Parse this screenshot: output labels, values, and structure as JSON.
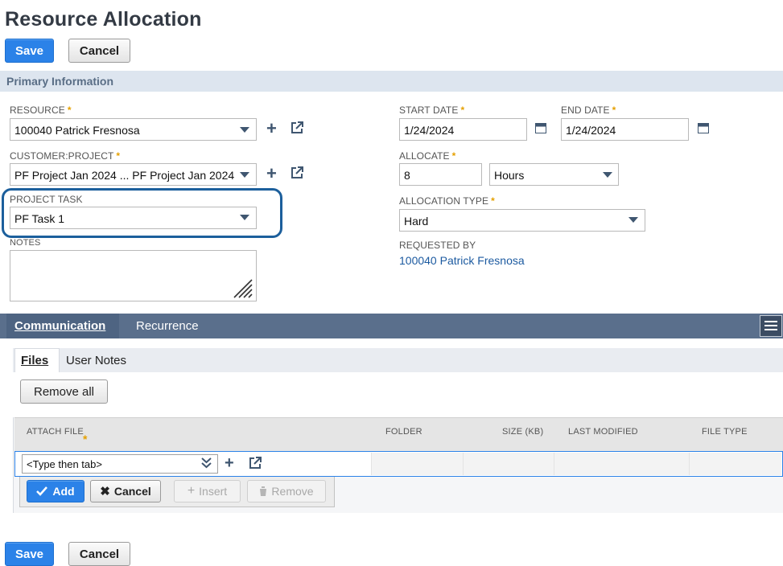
{
  "page": {
    "title": "Resource Allocation"
  },
  "top_actions": {
    "save": "Save",
    "cancel": "Cancel"
  },
  "bottom_actions": {
    "save": "Save",
    "cancel": "Cancel"
  },
  "section": {
    "title": "Primary Information"
  },
  "fields": {
    "resource": {
      "label": "RESOURCE",
      "value": "100040 Patrick Fresnosa",
      "required": "*"
    },
    "customer_project": {
      "label": "CUSTOMER:PROJECT",
      "value": "PF Project Jan 2024 ... PF Project Jan 2024",
      "required": "*"
    },
    "project_task": {
      "label": "PROJECT TASK",
      "value": "PF Task 1"
    },
    "notes": {
      "label": "NOTES",
      "value": ""
    },
    "start_date": {
      "label": "START DATE",
      "value": "1/24/2024",
      "required": "*"
    },
    "end_date": {
      "label": "END DATE",
      "value": "1/24/2024",
      "required": "*"
    },
    "allocate": {
      "label": "ALLOCATE",
      "value": "8",
      "unit": "Hours",
      "required": "*"
    },
    "allocation_type": {
      "label": "ALLOCATION TYPE",
      "value": "Hard",
      "required": "*"
    },
    "requested_by": {
      "label": "REQUESTED BY",
      "value": "100040 Patrick Fresnosa"
    }
  },
  "tabs": [
    {
      "label": "Communication",
      "active": true
    },
    {
      "label": "Recurrence",
      "active": false
    }
  ],
  "subtabs": [
    {
      "label": "Files",
      "active": true
    },
    {
      "label": "User Notes",
      "active": false
    }
  ],
  "files": {
    "remove_all": "Remove all",
    "columns": [
      "ATTACH FILE",
      "FOLDER",
      "SIZE (KB)",
      "LAST MODIFIED",
      "FILE TYPE"
    ],
    "attach_placeholder": "<Type then tab>",
    "row_actions": {
      "add": "Add",
      "cancel": "Cancel",
      "insert": "Insert",
      "remove": "Remove"
    }
  },
  "colors": {
    "primary_button": "#2b82e8",
    "tab_bar": "#5a6f8c",
    "highlight_border": "#1c5f9c",
    "link": "#1c5aa0",
    "required_star": "#e5a000"
  },
  "icons": [
    "plus-icon",
    "open-external-icon",
    "calendar-icon",
    "dropdown-caret-icon",
    "menu-icon",
    "checkmark-icon",
    "close-x-icon",
    "trash-icon",
    "resize-grip-icon",
    "double-chevron-down-icon"
  ]
}
